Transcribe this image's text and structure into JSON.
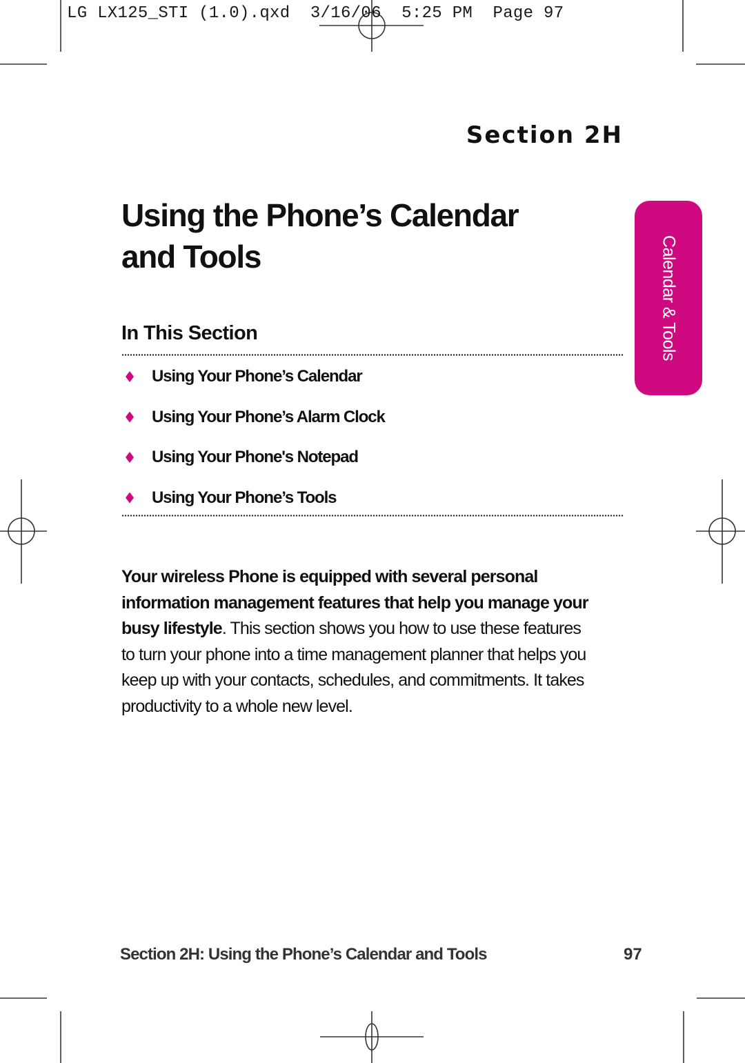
{
  "slug_line": "LG LX125_STI (1.0).qxd  3/16/06  5:25 PM  Page 97",
  "section_label": "Section 2H",
  "page_title_line1": "Using the Phone’s Calendar",
  "page_title_line2": "and Tools",
  "side_tab": {
    "label": "Calendar & Tools",
    "color": "#CF0A80"
  },
  "in_this_section": {
    "heading": "In This Section",
    "items": [
      {
        "label": "Using Your Phone’s Calendar",
        "bullet_icon": "diamond-icon"
      },
      {
        "label": "Using Your Phone’s Alarm Clock",
        "bullet_icon": "diamond-icon"
      },
      {
        "label": "Using Your Phone's Notepad",
        "bullet_icon": "diamond-icon"
      },
      {
        "label": "Using Your Phone’s Tools",
        "bullet_icon": "diamond-icon"
      }
    ]
  },
  "intro": {
    "bold": "Your wireless Phone is equipped with several personal information management features that help you manage your busy lifestyle",
    "rest": ". This section shows you how to use these features to turn your phone into a time management planner that helps you keep up with your contacts, schedules, and commitments. It takes productivity to a whole new level."
  },
  "footer": {
    "running_title": "Section 2H: Using the Phone’s Calendar and Tools",
    "page_number": "97"
  },
  "accent_color": "#CF0A80"
}
